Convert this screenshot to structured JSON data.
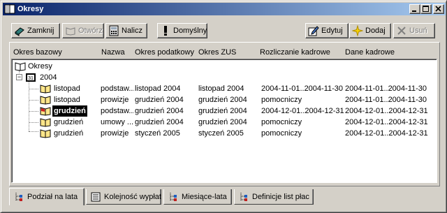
{
  "window": {
    "title": "Okresy"
  },
  "toolbar": {
    "zamknij": "Zamknij",
    "otworz": "Otwórz",
    "nalicz": "Nalicz",
    "domyslny": "Domyślny",
    "edytuj": "Edytuj",
    "dodaj": "Dodaj",
    "usun": "Usuń"
  },
  "columns": [
    "Okres bazowy",
    "Nazwa",
    "Okres podatkowy",
    "Okres ZUS",
    "Rozliczanie kadrowe",
    "Dane kadrowe"
  ],
  "tree": {
    "root": "Okresy",
    "year": "2004",
    "rows": [
      {
        "okres": "listopad",
        "nazwa": "podstaw...",
        "podatkowy": "listopad 2004",
        "zus": "listopad 2004",
        "rozliczanie": "2004-11-01..2004-11-30",
        "dane": "2004-11-01..2004-11-30"
      },
      {
        "okres": "listopad",
        "nazwa": "prowizje",
        "podatkowy": "grudzień 2004",
        "zus": "grudzień 2004",
        "rozliczanie": "pomocniczy",
        "dane": "2004-11-01..2004-11-30"
      },
      {
        "okres": "grudzień",
        "nazwa": "podstaw...",
        "podatkowy": "grudzień 2004",
        "zus": "grudzień 2004",
        "rozliczanie": "2004-12-01..2004-12-31",
        "dane": "2004-12-01..2004-12-31",
        "selected": true
      },
      {
        "okres": "grudzień",
        "nazwa": "umowy ...",
        "podatkowy": "grudzień 2004",
        "zus": "grudzień 2004",
        "rozliczanie": "pomocniczy",
        "dane": "2004-12-01..2004-12-31"
      },
      {
        "okres": "grudzień",
        "nazwa": "prowizje",
        "podatkowy": "styczeń 2005",
        "zus": "styczeń 2005",
        "rozliczanie": "pomocniczy",
        "dane": "2004-12-01..2004-12-31"
      }
    ]
  },
  "tabs": [
    "Podział na lata",
    "Kolejność wypłat",
    "Miesiące-lata",
    "Definicje list płac"
  ],
  "active_tab": "Podział na lata"
}
